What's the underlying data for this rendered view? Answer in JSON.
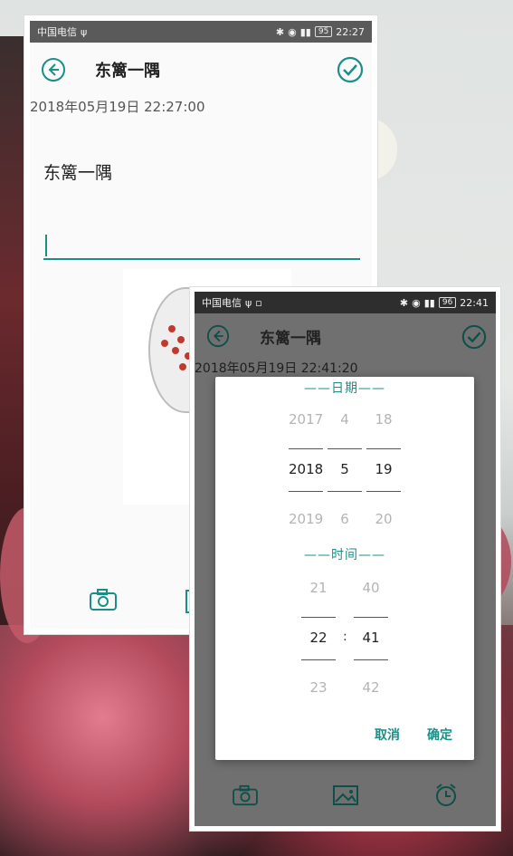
{
  "colors": {
    "accent": "#1a8f87",
    "statusbar": "#5a5a5a",
    "dim_overlay": "#707070"
  },
  "screen1": {
    "status": {
      "carrier": "中国电信",
      "battery": "95",
      "time": "22:27"
    },
    "title": "东篱一隅",
    "datetime": "2018年05月19日 22:27:00",
    "content_title": "东篱一隅",
    "icons": [
      "back-icon",
      "check-icon",
      "camera-icon"
    ]
  },
  "screen2": {
    "status": {
      "carrier": "中国电信",
      "battery": "96",
      "time": "22:41"
    },
    "title": "东篱一隅",
    "datetime": "2018年05月19日 22:41:20",
    "dialog": {
      "date_label": "——日期——",
      "time_label": "——时间——",
      "year": [
        "2017",
        "2018",
        "2019"
      ],
      "month": [
        "4",
        "5",
        "6"
      ],
      "day": [
        "18",
        "19",
        "20"
      ],
      "hour": [
        "21",
        "22",
        "23"
      ],
      "minute": [
        "40",
        "41",
        "42"
      ],
      "separator": ":",
      "cancel": "取消",
      "confirm": "确定"
    },
    "icons": [
      "camera-icon",
      "image-icon",
      "alarm-icon"
    ]
  }
}
